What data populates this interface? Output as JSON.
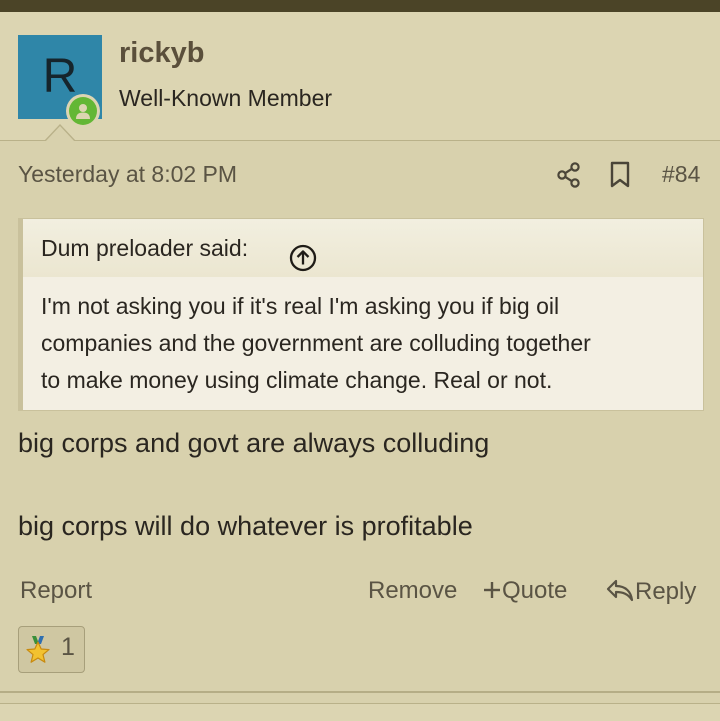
{
  "post": {
    "user": {
      "avatar_letter": "R",
      "avatar_color": "#2f86a8",
      "online_status_color": "#63b735",
      "name": "rickyb",
      "title": "Well-Known Member"
    },
    "date": "Yesterday at 8:02 PM",
    "number": "#84",
    "quote": {
      "author_said": "Dum preloader said:",
      "lines": [
        "I'm not asking you if it's real I'm asking you if big oil",
        "companies and the government are colluding together",
        "to make money using climate change. Real or not."
      ]
    },
    "message": {
      "line1": "big corps and govt are always colluding",
      "line2": "big corps will do whatever is profitable"
    },
    "actions": {
      "report": "Report",
      "remove": "Remove",
      "quote": "Quote",
      "reply": "Reply"
    },
    "reaction": {
      "icon": "star-medal-icon",
      "count": "1"
    }
  },
  "colors": {
    "top_bar": "#4b4427",
    "background": "#d8d1ad",
    "accent_text": "#5a4f3b"
  }
}
